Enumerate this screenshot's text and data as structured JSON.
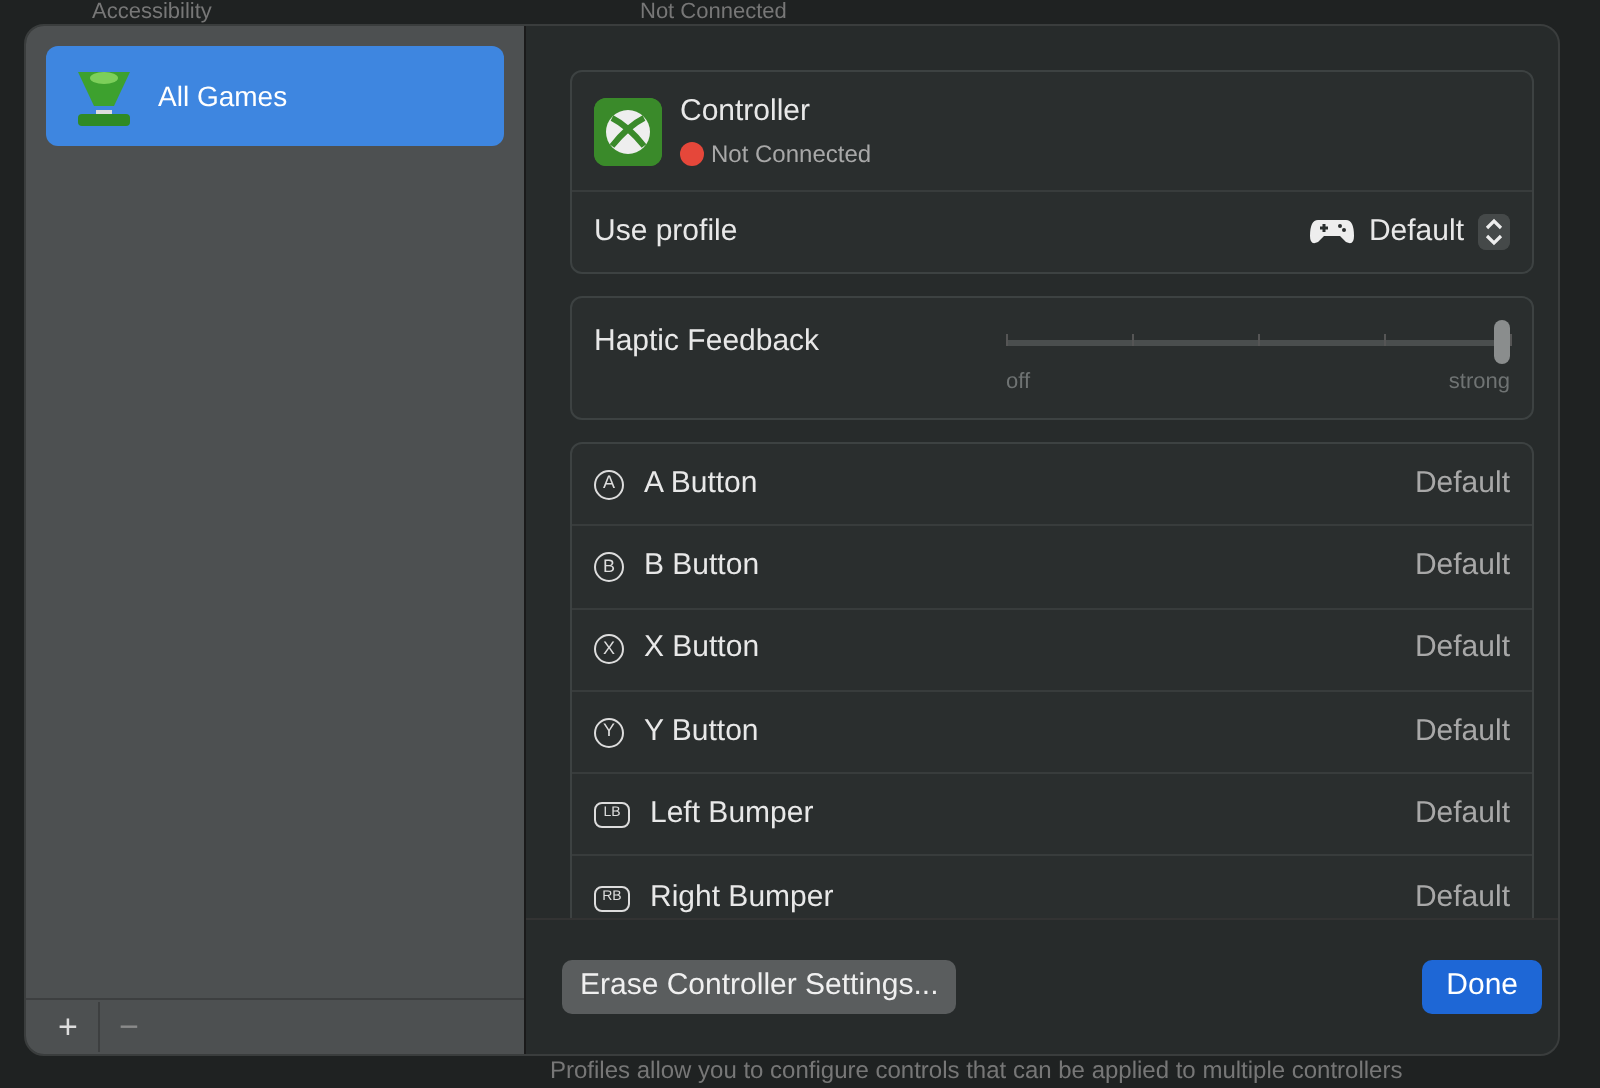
{
  "background": {
    "top_sidebar_item": "Accessibility",
    "top_status": "Not Connected",
    "footer_note": "Profiles allow you to configure controls that can be applied to multiple controllers"
  },
  "sidebar": {
    "items": [
      {
        "label": "All Games",
        "selected": true
      }
    ],
    "add": "+",
    "remove": "−"
  },
  "controller": {
    "name": "Controller",
    "status": "Not Connected",
    "color": "#e5473a"
  },
  "use_profile": {
    "label": "Use profile",
    "value": "Default"
  },
  "haptic": {
    "label": "Haptic Feedback",
    "level": 1,
    "min_label": "off",
    "max_label": "strong"
  },
  "mappings": [
    {
      "kind": "round",
      "glyph": "A",
      "label": "A Button",
      "value": "Default"
    },
    {
      "kind": "round",
      "glyph": "B",
      "label": "B Button",
      "value": "Default"
    },
    {
      "kind": "round",
      "glyph": "X",
      "label": "X Button",
      "value": "Default"
    },
    {
      "kind": "round",
      "glyph": "Y",
      "label": "Y Button",
      "value": "Default"
    },
    {
      "kind": "bumper",
      "glyph": "LB",
      "label": "Left Bumper",
      "value": "Default"
    },
    {
      "kind": "bumper",
      "glyph": "RB",
      "label": "Right Bumper",
      "value": "Default"
    }
  ],
  "buttons": {
    "erase": "Erase Controller Settings...",
    "done": "Done"
  }
}
